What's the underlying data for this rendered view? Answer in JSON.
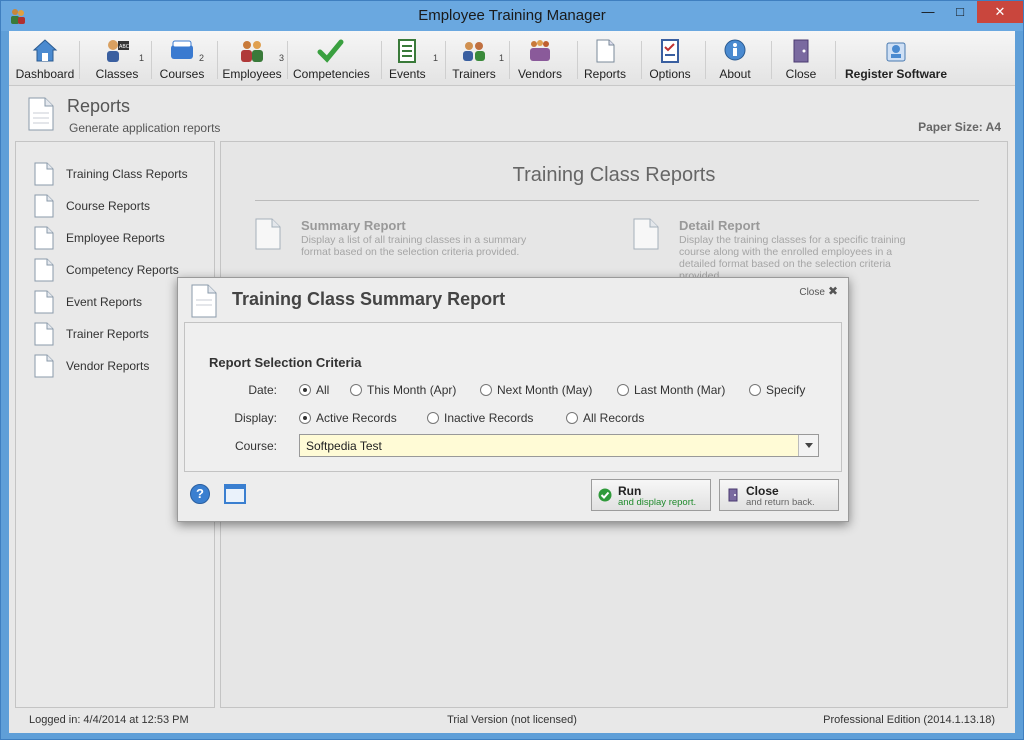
{
  "window": {
    "title": "Employee Training Manager"
  },
  "toolbar": {
    "items": [
      {
        "label": "Dashboard",
        "icon": "house-icon",
        "count": ""
      },
      {
        "label": "Classes",
        "icon": "teacher-icon",
        "count": "1"
      },
      {
        "label": "Courses",
        "icon": "books-icon",
        "count": "2"
      },
      {
        "label": "Employees",
        "icon": "people-icon",
        "count": "3"
      },
      {
        "label": "Competencies",
        "icon": "checkmark-icon",
        "count": ""
      },
      {
        "label": "Events",
        "icon": "clipboard-icon",
        "count": "1"
      },
      {
        "label": "Trainers",
        "icon": "trainers-icon",
        "count": "1"
      },
      {
        "label": "Vendors",
        "icon": "group-icon",
        "count": ""
      },
      {
        "label": "Reports",
        "icon": "document-icon",
        "count": ""
      },
      {
        "label": "Options",
        "icon": "checklist-icon",
        "count": ""
      },
      {
        "label": "About",
        "icon": "info-icon",
        "count": ""
      },
      {
        "label": "Close",
        "icon": "door-icon",
        "count": ""
      },
      {
        "label": "Register Software",
        "icon": "register-icon",
        "count": ""
      }
    ]
  },
  "page": {
    "title": "Reports",
    "subtitle": "Generate application reports",
    "paper_size": "Paper Size: A4"
  },
  "sidebar": {
    "items": [
      {
        "label": "Training Class Reports"
      },
      {
        "label": "Course Reports"
      },
      {
        "label": "Employee Reports"
      },
      {
        "label": "Competency Reports"
      },
      {
        "label": "Event Reports"
      },
      {
        "label": "Trainer Reports"
      },
      {
        "label": "Vendor Reports"
      }
    ]
  },
  "main": {
    "title": "Training Class Reports",
    "cards": [
      {
        "title": "Summary Report",
        "description": "Display a list of all training classes in a summary format based on the selection criteria provided."
      },
      {
        "title": "Detail Report",
        "description": "Display the training classes for a specific training course along with the enrolled employees in a detailed format based on the selection criteria provided."
      }
    ]
  },
  "dialog": {
    "title": "Training Class Summary Report",
    "close_label": "Close",
    "criteria_title": "Report Selection Criteria",
    "date": {
      "label": "Date:",
      "options": [
        "All",
        "This Month (Apr)",
        "Next Month (May)",
        "Last Month (Mar)",
        "Specify"
      ],
      "selected": 0
    },
    "display": {
      "label": "Display:",
      "options": [
        "Active Records",
        "Inactive Records",
        "All Records"
      ],
      "selected": 0
    },
    "course": {
      "label": "Course:",
      "value": "Softpedia Test"
    },
    "run_button": {
      "label": "Run",
      "sub": "and display report."
    },
    "close_button": {
      "label": "Close",
      "sub": "and return back."
    }
  },
  "status": {
    "logged_in": "Logged in:  4/4/2014 at 12:53 PM",
    "license": "Trial Version (not licensed)",
    "edition": "Professional Edition (2014.1.13.18)"
  },
  "colors": {
    "accent": "#3a7fd0",
    "titlebar": "#6aa8e0",
    "close_red": "#c9463d",
    "field_yellow": "#fffbd6"
  }
}
